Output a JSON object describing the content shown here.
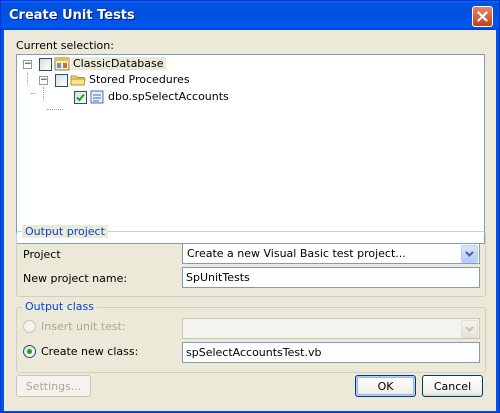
{
  "window": {
    "title": "Create Unit Tests"
  },
  "selection": {
    "label": "Current selection:",
    "tree": {
      "database": "ClassicDatabase",
      "folder": "Stored Procedures",
      "procedure": "dbo.spSelectAccounts"
    }
  },
  "output_project": {
    "group_title": "Output project",
    "project_label": "Project",
    "project_value": "Create a new Visual Basic test project...",
    "name_label": "New project name:",
    "name_value": "SpUnitTests"
  },
  "output_class": {
    "group_title": "Output class",
    "insert_label": "Insert unit test:",
    "insert_value": "",
    "create_label": "Create new class:",
    "create_value": "spSelectAccountsTest.vb",
    "selected_option": "Create new class:"
  },
  "buttons": {
    "settings": "Settings...",
    "ok": "OK",
    "cancel": "Cancel"
  },
  "icons": {
    "close": "close-icon",
    "database": "database-icon",
    "folder": "folder-icon",
    "procedure": "stored-procedure-icon",
    "dropdown": "chevron-down-icon"
  },
  "colors": {
    "titlebar": "#0054E3",
    "group_title": "#0046D5",
    "dialog_bg": "#ECE9D8"
  }
}
